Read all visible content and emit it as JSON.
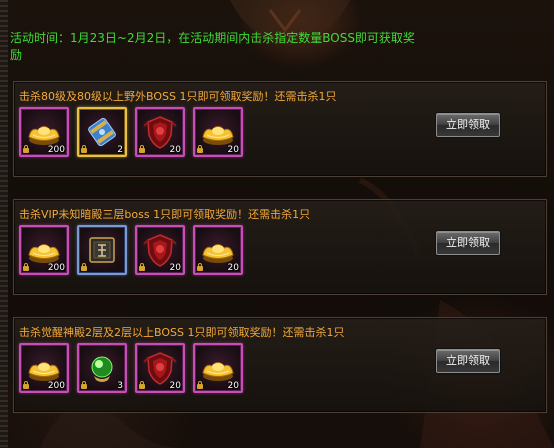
{
  "event": {
    "intro_line1": "活动时间：1月23日~2月2日，在活动期间内击杀指定数量BOSS即可获取奖",
    "intro_line2": "励"
  },
  "tasks": [
    {
      "title": "击杀80级及80级以上野外BOSS    1只即可领取奖励！还需击杀1只",
      "items": [
        {
          "icon": "gold-ingot-icon",
          "qty": "200"
        },
        {
          "icon": "scroll-icon",
          "qty": "2"
        },
        {
          "icon": "red-shield-icon",
          "qty": "20"
        },
        {
          "icon": "gold-ingot-icon",
          "qty": "20"
        }
      ],
      "button": "立即领取"
    },
    {
      "title": "击杀VIP未知暗殿三层boss      1只即可领取奖励！还需击杀1只",
      "items": [
        {
          "icon": "gold-ingot-icon",
          "qty": "200"
        },
        {
          "icon": "rune-tablet-icon",
          "qty": ""
        },
        {
          "icon": "red-shield-icon",
          "qty": "20"
        },
        {
          "icon": "gold-ingot-icon",
          "qty": "20"
        }
      ],
      "button": "立即领取"
    },
    {
      "title": "击杀觉醒神殿2层及2层以上BOSS 1只即可领取奖励！还需击杀1只",
      "items": [
        {
          "icon": "gold-ingot-icon",
          "qty": "200"
        },
        {
          "icon": "green-orb-icon",
          "qty": "3"
        },
        {
          "icon": "red-shield-icon",
          "qty": "20"
        },
        {
          "icon": "gold-ingot-icon",
          "qty": "20"
        }
      ],
      "button": "立即领取"
    }
  ],
  "colors": {
    "intro_text": "#3fdc37",
    "title_text": "#f4a93a",
    "slot_pink_border": "#c64fb4",
    "slot_gold_border": "#e7c04a",
    "slot_blue_border": "#7b9ad2"
  }
}
